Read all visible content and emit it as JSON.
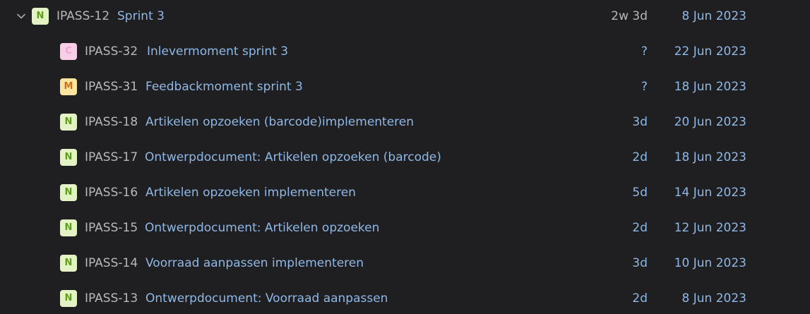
{
  "parent": {
    "type_letter": "N",
    "key": "IPASS-12",
    "title": "Sprint 3",
    "estimate": "2w 3d",
    "date": "8 Jun 2023"
  },
  "children": [
    {
      "type_letter": "C",
      "key": "IPASS-32",
      "title": "Inlevermoment sprint 3",
      "estimate": "?",
      "date": "22 Jun 2023"
    },
    {
      "type_letter": "M",
      "key": "IPASS-31",
      "title": "Feedbackmoment sprint 3",
      "estimate": "?",
      "date": "18 Jun 2023"
    },
    {
      "type_letter": "N",
      "key": "IPASS-18",
      "title": "Artikelen opzoeken (barcode)implementeren",
      "estimate": "3d",
      "date": "20 Jun 2023"
    },
    {
      "type_letter": "N",
      "key": "IPASS-17",
      "title": "Ontwerpdocument: Artikelen opzoeken (barcode)",
      "estimate": "2d",
      "date": "18 Jun 2023"
    },
    {
      "type_letter": "N",
      "key": "IPASS-16",
      "title": "Artikelen opzoeken implementeren",
      "estimate": "5d",
      "date": "14 Jun 2023"
    },
    {
      "type_letter": "N",
      "key": "IPASS-15",
      "title": "Ontwerpdocument: Artikelen opzoeken",
      "estimate": "2d",
      "date": "12 Jun 2023"
    },
    {
      "type_letter": "N",
      "key": "IPASS-14",
      "title": "Voorraad aanpassen implementeren",
      "estimate": "3d",
      "date": "10 Jun 2023"
    },
    {
      "type_letter": "N",
      "key": "IPASS-13",
      "title": "Ontwerpdocument: Voorraad aanpassen",
      "estimate": "2d",
      "date": "8 Jun 2023"
    }
  ],
  "colors": {
    "background": "#1f1f21",
    "key_text": "#b8b8bc",
    "link_text": "#8fb8e6",
    "badge_n_bg": "#e3f3c4",
    "badge_n_fg": "#5fa01b",
    "badge_c_bg": "#f7cde7",
    "badge_c_fg": "#f1a4d3",
    "badge_m_bg": "#fbe49d",
    "badge_m_fg": "#cf6f19"
  },
  "icons": {
    "expander": "chevron-down-icon"
  }
}
